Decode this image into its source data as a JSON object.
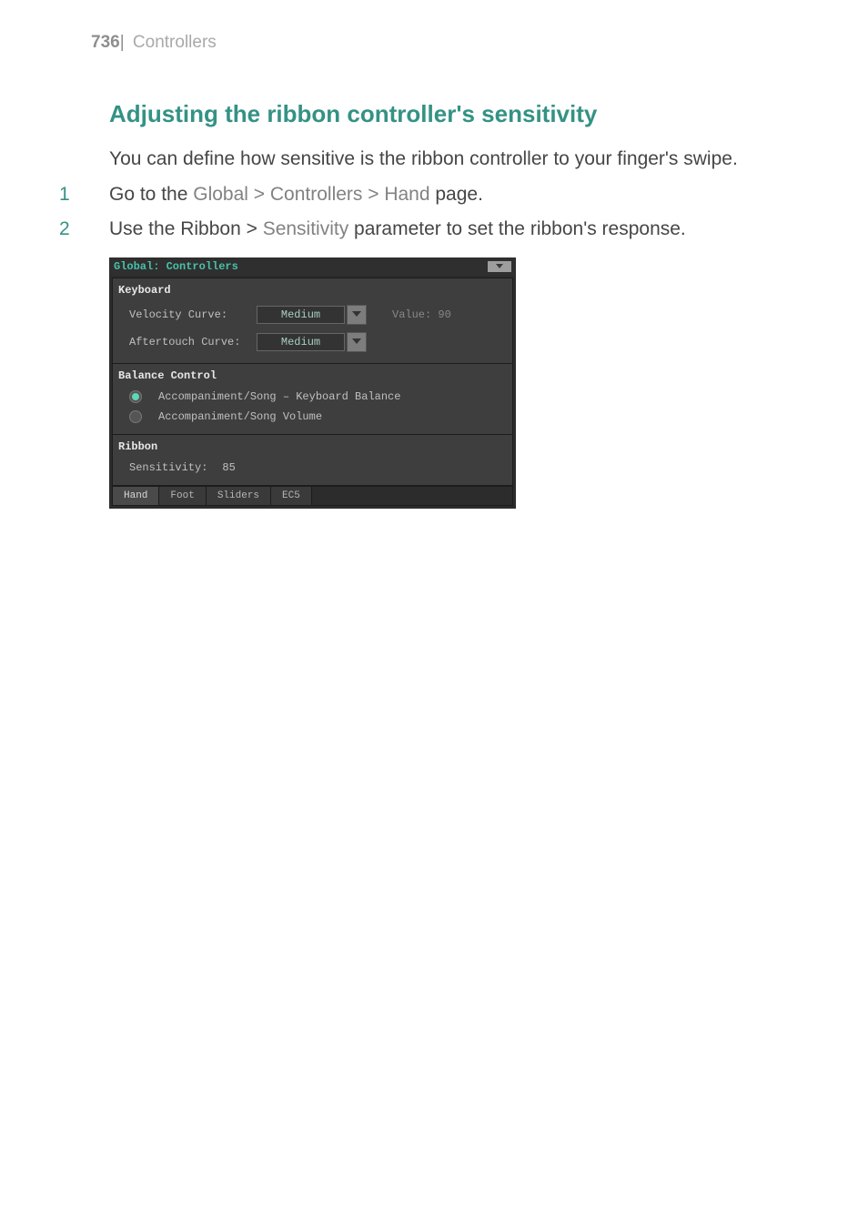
{
  "header": {
    "page_number": "736",
    "separator": "|",
    "section": "Controllers"
  },
  "subheading": "Adjusting the ribbon controller's sensitivity",
  "intro": "You can define how sensitive is the ribbon controller to your finger's swipe.",
  "steps": {
    "s1": {
      "num": "1",
      "pre": "Go to the ",
      "path": "Global > Controllers > Hand",
      "post": " page."
    },
    "s2": {
      "num": "2",
      "pre": "Use the Ribbon > ",
      "param": "Sensitivity",
      "post": " parameter to set the ribbon's response."
    }
  },
  "ui": {
    "title": "Global: Controllers",
    "keyboard": {
      "header": "Keyboard",
      "velocity_label": "Velocity Curve:",
      "velocity_value": "Medium",
      "value_label": "Value:",
      "value_num": "90",
      "aftertouch_label": "Aftertouch Curve:",
      "aftertouch_value": "Medium"
    },
    "balance": {
      "header": "Balance Control",
      "opt1": "Accompaniment/Song – Keyboard Balance",
      "opt2": "Accompaniment/Song Volume"
    },
    "ribbon": {
      "header": "Ribbon",
      "sens_label": "Sensitivity:",
      "sens_value": "85"
    },
    "tabs": {
      "hand": "Hand",
      "foot": "Foot",
      "sliders": "Sliders",
      "ec5": "EC5"
    }
  }
}
